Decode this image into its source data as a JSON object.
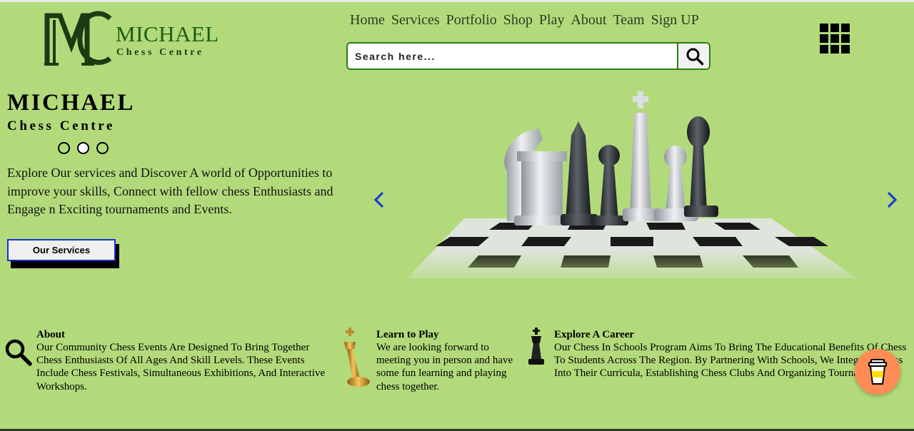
{
  "colors": {
    "background": "#b2da7b",
    "brand_green": "#1e5c12",
    "search_border": "#2b7d18",
    "button_border": "#1a2fd6",
    "arrow": "#1a3fd0",
    "fab": "#ff8c55"
  },
  "logo": {
    "monogram": "MC",
    "title": "MICHAEL",
    "subtitle": "Chess Centre"
  },
  "nav": {
    "items": [
      "Home",
      "Services",
      "Portfolio",
      "Shop",
      "Play",
      "About",
      "Team",
      "Sign UP"
    ]
  },
  "search": {
    "placeholder": "Search here...",
    "icon": "search-icon"
  },
  "menu": {
    "icon": "grid-menu-icon"
  },
  "hero": {
    "title": "MICHAEL",
    "subtitle": "Chess Centre",
    "slides": 3,
    "active_slide": 2,
    "description": "Explore Our services and Discover A world of Opportunities to improve your skills, Connect with fellow chess Enthusiasts and Engage n Exciting tournaments and Events.",
    "button": "Our Services",
    "prev_icon": "chevron-left-icon",
    "next_icon": "chevron-right-icon"
  },
  "features": [
    {
      "icon": "magnifier-icon",
      "title": "About",
      "text": "Our Community Chess Events Are Designed To Bring Together Chess Enthusiasts Of All Ages And Skill Levels. These Events Include Chess Festivals, Simultaneous Exhibitions, And Interactive Workshops."
    },
    {
      "icon": "gold-king-icon",
      "title": "Learn to Play",
      "text": "We are looking forward to meeting you in person and have some fun learning and playing chess together."
    },
    {
      "icon": "black-king-icon",
      "title": "Explore A Career",
      "text": "Our Chess In Schools Program Aims To Bring The Educational Benefits Of Chess To Students Across The Region. By Partnering With Schools, We Integrate Chess Into Their Curricula, Establishing Chess Clubs And Organizing Tournaments."
    }
  ],
  "fab": {
    "icon": "coffee-cup-icon"
  }
}
